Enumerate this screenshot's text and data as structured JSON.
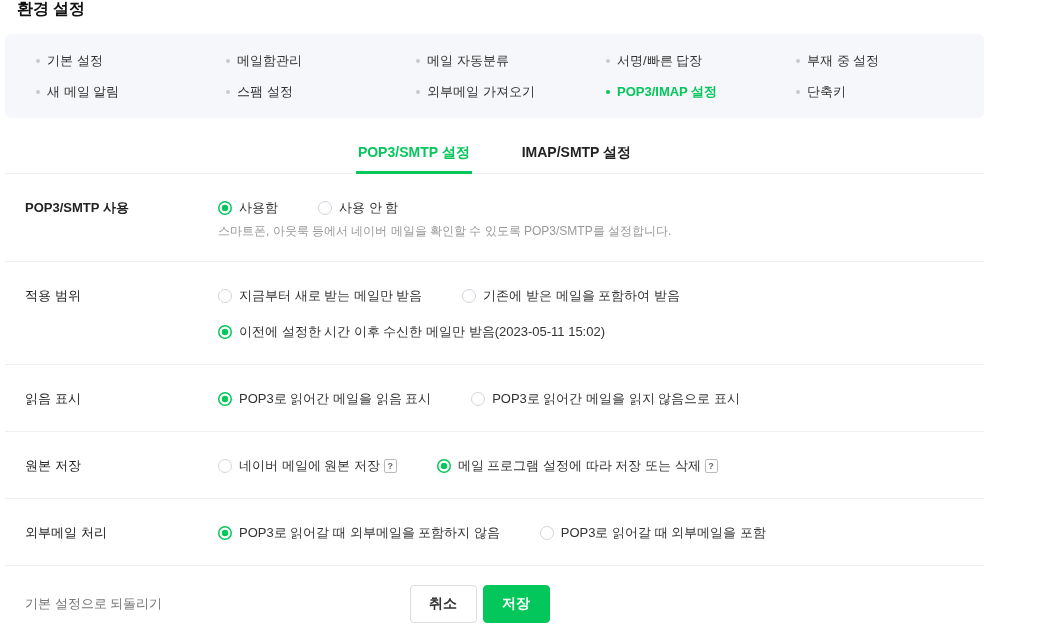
{
  "page": {
    "title": "환경 설정"
  },
  "menu": [
    {
      "label": "기본 설정",
      "selected": false
    },
    {
      "label": "메일함관리",
      "selected": false
    },
    {
      "label": "메일 자동분류",
      "selected": false
    },
    {
      "label": "서명/빠른 답장",
      "selected": false
    },
    {
      "label": "부재 중 설정",
      "selected": false
    },
    {
      "label": "새 메일 알림",
      "selected": false
    },
    {
      "label": "스팸 설정",
      "selected": false
    },
    {
      "label": "외부메일 가져오기",
      "selected": false
    },
    {
      "label": "POP3/IMAP 설정",
      "selected": true
    },
    {
      "label": "단축키",
      "selected": false
    }
  ],
  "tabs": [
    {
      "label": "POP3/SMTP 설정",
      "selected": true
    },
    {
      "label": "IMAP/SMTP 설정",
      "selected": false
    }
  ],
  "settings": [
    {
      "label": "POP3/SMTP 사용",
      "bold": true,
      "option_rows": [
        [
          {
            "label": "사용함",
            "selected": true
          },
          {
            "label": "사용 안 함",
            "selected": false
          }
        ]
      ],
      "hint": "스마트폰, 아웃룩 등에서 네이버 메일을 확인할 수 있도록 POP3/SMTP를 설정합니다."
    },
    {
      "label": "적용 범위",
      "bold": false,
      "option_rows": [
        [
          {
            "label": "지금부터 새로 받는 메일만 받음",
            "selected": false
          },
          {
            "label": "기존에 받은 메일을 포함하여 받음",
            "selected": false
          }
        ],
        [
          {
            "label": "이전에 설정한 시간 이후 수신한 메일만 받음(2023-05-11 15:02)",
            "selected": true
          }
        ]
      ]
    },
    {
      "label": "읽음 표시",
      "bold": false,
      "option_rows": [
        [
          {
            "label": "POP3로 읽어간 메일을 읽음 표시",
            "selected": true
          },
          {
            "label": "POP3로 읽어간 메일을 읽지 않음으로 표시",
            "selected": false
          }
        ]
      ]
    },
    {
      "label": "원본 저장",
      "bold": false,
      "option_rows": [
        [
          {
            "label": "네이버 메일에 원본 저장",
            "selected": false,
            "help": "?"
          },
          {
            "label": "메일 프로그램 설정에 따라 저장 또는 삭제",
            "selected": true,
            "help": "?"
          }
        ]
      ]
    },
    {
      "label": "외부메일 처리",
      "bold": false,
      "option_rows": [
        [
          {
            "label": "POP3로 읽어갈 때 외부메일을 포함하지 않음",
            "selected": true
          },
          {
            "label": "POP3로 읽어갈 때 외부메일을 포함",
            "selected": false
          }
        ]
      ]
    }
  ],
  "footer": {
    "reset_link": "기본 설정으로 되돌리기",
    "buttons": [
      {
        "label": "취소",
        "kind": "secondary"
      },
      {
        "label": "저장",
        "kind": "primary"
      }
    ]
  }
}
